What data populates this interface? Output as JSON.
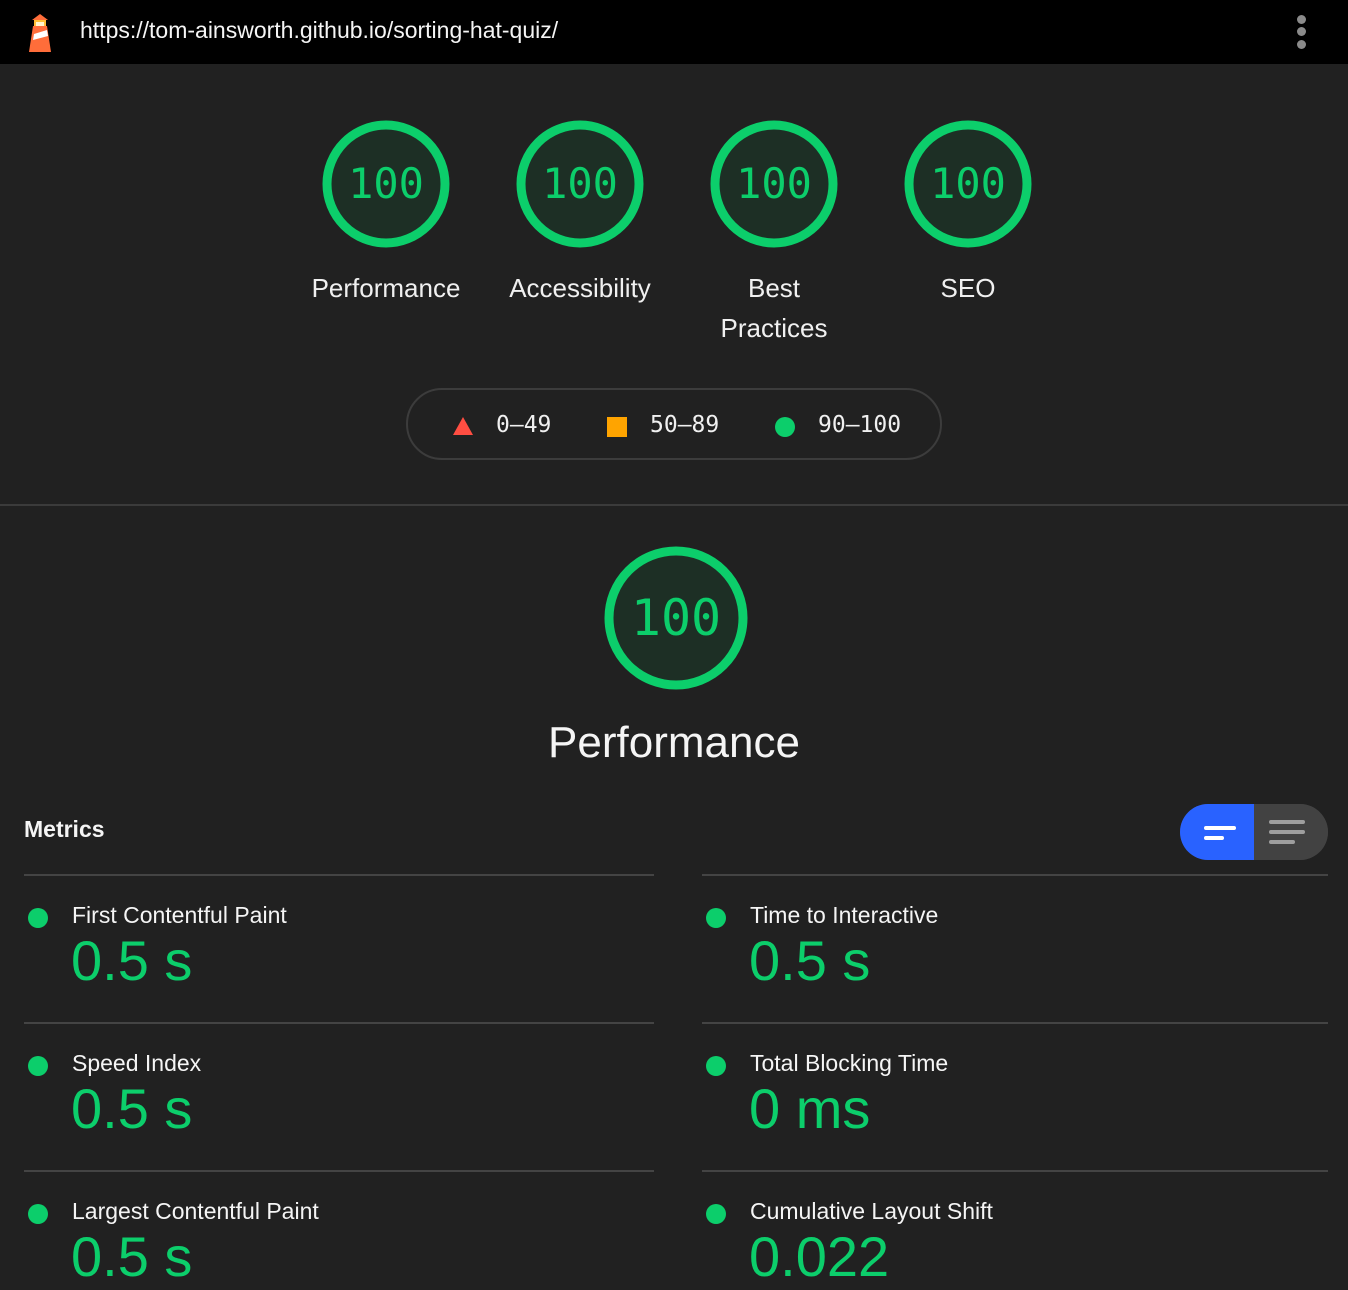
{
  "topbar": {
    "url": "https://tom-ainsworth.github.io/sorting-hat-quiz/",
    "logo_icon": "lighthouse-icon",
    "menu_icon": "kebab-menu-icon"
  },
  "gauges": [
    {
      "score": "100",
      "label": "Performance",
      "label_line2": ""
    },
    {
      "score": "100",
      "label": "Accessibility",
      "label_line2": ""
    },
    {
      "score": "100",
      "label": "Best",
      "label_line2": "Practices"
    },
    {
      "score": "100",
      "label": "SEO",
      "label_line2": ""
    }
  ],
  "legend": {
    "fail": "0–49",
    "average": "50–89",
    "pass": "90–100"
  },
  "performance": {
    "score": "100",
    "title": "Performance"
  },
  "metrics": {
    "heading": "Metrics",
    "items": [
      {
        "label": "First Contentful Paint",
        "value": "0.5 s"
      },
      {
        "label": "Time to Interactive",
        "value": "0.5 s"
      },
      {
        "label": "Speed Index",
        "value": "0.5 s"
      },
      {
        "label": "Total Blocking Time",
        "value": "0 ms"
      },
      {
        "label": "Largest Contentful Paint",
        "value": "0.5 s"
      },
      {
        "label": "Cumulative Layout Shift",
        "value": "0.022"
      }
    ]
  },
  "colors": {
    "pass": "#0cce6b",
    "average": "#ffa400",
    "fail": "#ff4e42",
    "toggle_active": "#2962ff"
  }
}
